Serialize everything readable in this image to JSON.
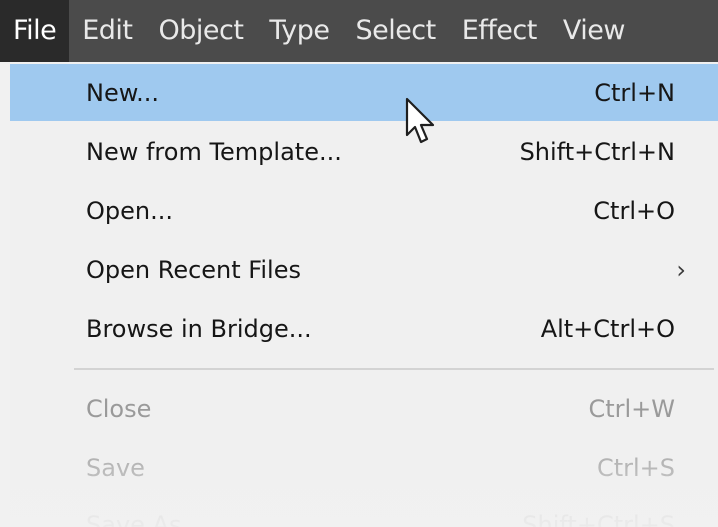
{
  "menubar": {
    "items": [
      {
        "label": "File"
      },
      {
        "label": "Edit"
      },
      {
        "label": "Object"
      },
      {
        "label": "Type"
      },
      {
        "label": "Select"
      },
      {
        "label": "Effect"
      },
      {
        "label": "View"
      }
    ]
  },
  "file_menu": {
    "items": [
      {
        "label": "New...",
        "shortcut": "Ctrl+N"
      },
      {
        "label": "New from Template...",
        "shortcut": "Shift+Ctrl+N"
      },
      {
        "label": "Open...",
        "shortcut": "Ctrl+O"
      },
      {
        "label": "Open Recent Files",
        "submenu_arrow": "›"
      },
      {
        "label": "Browse in Bridge...",
        "shortcut": "Alt+Ctrl+O"
      },
      {
        "label": "Close",
        "shortcut": "Ctrl+W"
      },
      {
        "label": "Save",
        "shortcut": "Ctrl+S"
      },
      {
        "label": "Save As...",
        "shortcut": "Shift+Ctrl+S"
      }
    ]
  },
  "cursor": {
    "icon": "arrow-cursor-icon"
  },
  "colors": {
    "menubar_bg": "#4b4b4b",
    "active_menu_bg": "#2a2a2a",
    "highlight": "#9fc9ef",
    "menu_bg": "#f0f0f0",
    "disabled_text": "#9a9a9a"
  }
}
